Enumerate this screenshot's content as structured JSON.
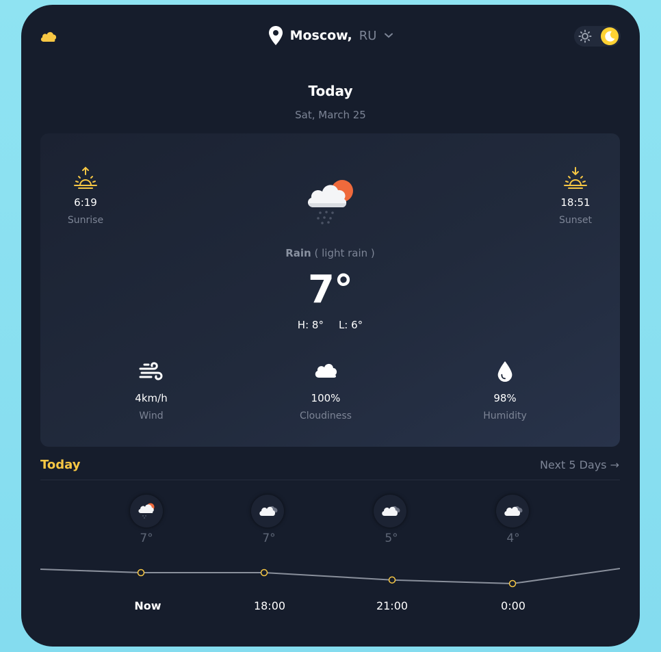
{
  "header": {
    "logo_icon": "cloud-icon",
    "city": "Moscow,",
    "country": "RU",
    "location_icon": "map-pin-icon",
    "dropdown_icon": "chevron-down-icon",
    "theme_light_icon": "sun-icon",
    "theme_dark_icon": "moon-icon",
    "active_theme": "dark"
  },
  "today": {
    "heading": "Today",
    "date": "Sat, March 25"
  },
  "current": {
    "sunrise_time": "6:19",
    "sunrise_label": "Sunrise",
    "sunset_time": "18:51",
    "sunset_label": "Sunset",
    "condition_main": "Rain",
    "condition_detail": " ( light rain )",
    "temperature": "7°",
    "high": "H: 8°",
    "low": "L: 6°",
    "icon": "rain-sun-cloud-icon"
  },
  "stats": [
    {
      "value": "4km/h",
      "label": "Wind",
      "icon": "wind-icon"
    },
    {
      "value": "100%",
      "label": "Cloudiness",
      "icon": "cloud-icon"
    },
    {
      "value": "98%",
      "label": "Humidity",
      "icon": "droplet-icon"
    }
  ],
  "forecast": {
    "title": "Today",
    "next_link": "Next 5 Days →",
    "hours": [
      {
        "label": "Now",
        "temp": "7°",
        "value": 7,
        "icon": "rain-sun-cloud-icon"
      },
      {
        "label": "18:00",
        "temp": "7°",
        "value": 7,
        "icon": "cloudy-icon"
      },
      {
        "label": "21:00",
        "temp": "5°",
        "value": 5,
        "icon": "cloudy-icon"
      },
      {
        "label": "0:00",
        "temp": "4°",
        "value": 4,
        "icon": "cloudy-icon"
      }
    ]
  },
  "colors": {
    "background": "#161d2c",
    "accent": "#f7c744",
    "muted": "#7d8596",
    "sun": "#ef6a3c"
  }
}
